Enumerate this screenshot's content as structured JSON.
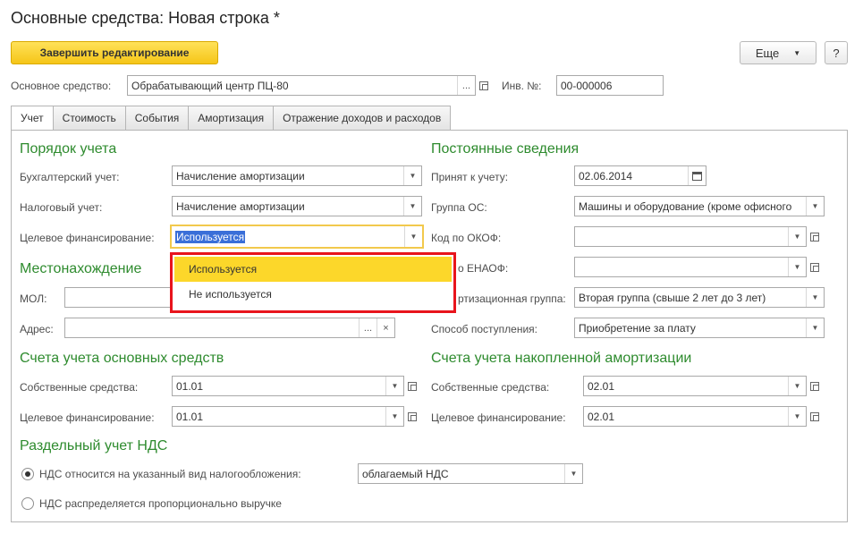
{
  "header": {
    "title": "Основные средства: Новая строка *",
    "finish_button": "Завершить редактирование",
    "more_button": "Еще",
    "help_button": "?"
  },
  "top": {
    "asset_label": "Основное средство:",
    "asset_value": "Обрабатывающий центр ПЦ-80",
    "inv_label": "Инв. №:",
    "inv_value": "00-000006"
  },
  "tabs": [
    "Учет",
    "Стоимость",
    "События",
    "Амортизация",
    "Отражение доходов и расходов"
  ],
  "left": {
    "order_title": "Порядок учета",
    "acc_label": "Бухгалтерский учет:",
    "acc_value": "Начисление амортизации",
    "tax_label": "Налоговый учет:",
    "tax_value": "Начисление амортизации",
    "fin_label": "Целевое финансирование:",
    "fin_value": "Используется",
    "location_title": "Местонахождение",
    "mol_label": "МОЛ:",
    "mol_value": "",
    "addr_label": "Адрес:",
    "addr_value": "",
    "accounts_title": "Счета учета основных средств",
    "own_label": "Собственные средства:",
    "own_value": "01.01",
    "tf_label": "Целевое финансирование:",
    "tf_value": "01.01"
  },
  "right": {
    "const_title": "Постоянные сведения",
    "accepted_label": "Принят к учету:",
    "accepted_value": "02.06.2014",
    "group_label": "Группа ОС:",
    "group_value": "Машины и оборудование (кроме офисного",
    "okof_label": "Код по ОКОФ:",
    "okof_value": "",
    "enaof_label": "о ЕНАОФ:",
    "enaof_value": "",
    "amort_group_label": "ртизационная группа:",
    "amort_group_value": "Вторая группа (свыше 2 лет до 3 лет)",
    "receipt_label": "Способ поступления:",
    "receipt_value": "Приобретение за плату",
    "dep_title": "Счета учета накопленной амортизации",
    "own_label": "Собственные средства:",
    "own_value": "02.01",
    "tf_label": "Целевое финансирование:",
    "tf_value": "02.01"
  },
  "vat": {
    "title": "Раздельный учет НДС",
    "opt1_label": "НДС относится на указанный вид налогообложения:",
    "opt1_value": "облагаемый НДС",
    "opt2_label": "НДС распределяется пропорционально выручке",
    "selected": 1
  },
  "dropdown": {
    "options": [
      "Используется",
      "Не используется"
    ],
    "selected_index": 0,
    "highlight_color": "#e8141c"
  },
  "colors": {
    "accent_yellow": "#f5c518",
    "section_green": "#2e8b2e"
  }
}
